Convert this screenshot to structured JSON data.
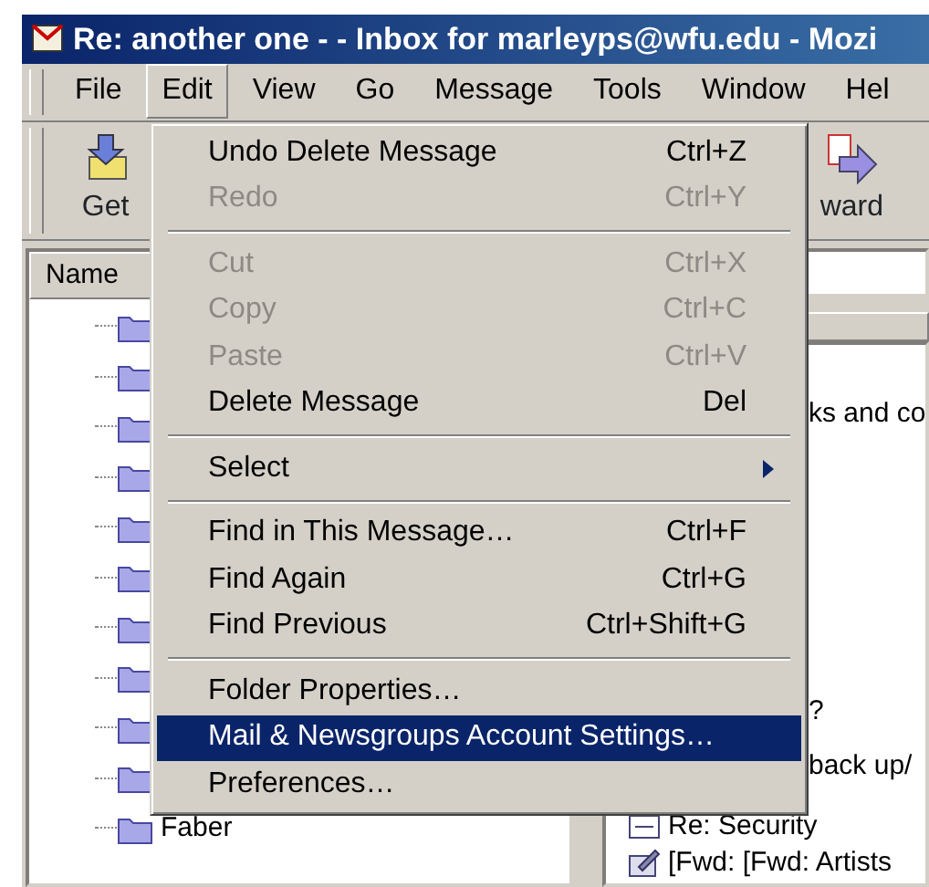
{
  "window": {
    "title": "Re: another one - - Inbox for marleyps@wfu.edu - Mozi"
  },
  "menubar": [
    {
      "label": "File",
      "selected": false
    },
    {
      "label": "Edit",
      "selected": true
    },
    {
      "label": "View",
      "selected": false
    },
    {
      "label": "Go",
      "selected": false
    },
    {
      "label": "Message",
      "selected": false
    },
    {
      "label": "Tools",
      "selected": false
    },
    {
      "label": "Window",
      "selected": false
    },
    {
      "label": "Hel",
      "selected": false
    }
  ],
  "toolbar": [
    {
      "label": "Get",
      "kind": "get"
    },
    {
      "label": "ward",
      "kind": "forward"
    }
  ],
  "folder_pane": {
    "column": "Name",
    "items": [
      {
        "kind": "folder"
      },
      {
        "kind": "folder"
      },
      {
        "kind": "folder"
      },
      {
        "kind": "folder"
      },
      {
        "kind": "folder"
      },
      {
        "kind": "folder"
      },
      {
        "kind": "folder"
      },
      {
        "kind": "folder"
      },
      {
        "kind": "folder"
      },
      {
        "kind": "folder"
      },
      {
        "kind": "folder",
        "label": "Faber"
      }
    ]
  },
  "message_pane": [
    {
      "text": "ks and co",
      "kind": "plain"
    },
    {
      "text": "?",
      "kind": "plain"
    },
    {
      "text": "back up/",
      "kind": "plain"
    },
    {
      "text": "Re: Security",
      "kind": "mail"
    },
    {
      "text": "[Fwd: [Fwd: Artists",
      "kind": "edit"
    }
  ],
  "edit_menu": [
    {
      "kind": "item",
      "label": "Undo Delete Message",
      "shortcut": "Ctrl+Z",
      "disabled": false,
      "selected": false
    },
    {
      "kind": "item",
      "label": "Redo",
      "shortcut": "Ctrl+Y",
      "disabled": true,
      "selected": false
    },
    {
      "kind": "separator"
    },
    {
      "kind": "item",
      "label": "Cut",
      "shortcut": "Ctrl+X",
      "disabled": true,
      "selected": false
    },
    {
      "kind": "item",
      "label": "Copy",
      "shortcut": "Ctrl+C",
      "disabled": true,
      "selected": false
    },
    {
      "kind": "item",
      "label": "Paste",
      "shortcut": "Ctrl+V",
      "disabled": true,
      "selected": false
    },
    {
      "kind": "item",
      "label": "Delete Message",
      "shortcut": "Del",
      "disabled": false,
      "selected": false
    },
    {
      "kind": "separator"
    },
    {
      "kind": "submenu",
      "label": "Select",
      "disabled": false,
      "selected": false
    },
    {
      "kind": "separator"
    },
    {
      "kind": "item",
      "label": "Find in This Message…",
      "shortcut": "Ctrl+F",
      "disabled": false,
      "selected": false
    },
    {
      "kind": "item",
      "label": "Find Again",
      "shortcut": "Ctrl+G",
      "disabled": false,
      "selected": false
    },
    {
      "kind": "item",
      "label": "Find Previous",
      "shortcut": "Ctrl+Shift+G",
      "disabled": false,
      "selected": false
    },
    {
      "kind": "separator"
    },
    {
      "kind": "item",
      "label": "Folder Properties…",
      "disabled": false,
      "selected": false
    },
    {
      "kind": "item",
      "label": "Mail & Newsgroups Account Settings…",
      "disabled": false,
      "selected": true
    },
    {
      "kind": "item",
      "label": "Preferences…",
      "disabled": false,
      "selected": false
    }
  ]
}
